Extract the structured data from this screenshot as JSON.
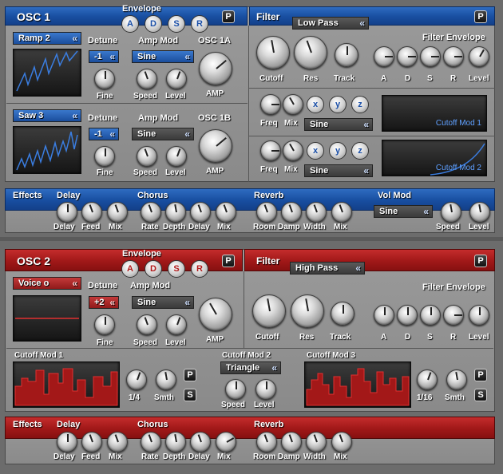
{
  "colors": {
    "blue": "#1a4fa8",
    "red": "#a31a1a",
    "panel": "#8f8f8f"
  },
  "osc_section": {
    "title": "OSC 1",
    "envelope_label": "Envelope",
    "env_buttons": [
      "A",
      "D",
      "S",
      "R"
    ],
    "p": "P",
    "filter_label": "Filter",
    "filter_type": "Low Pass",
    "filter_env_label": "Filter Envelope",
    "filter_knobs": [
      "Cutoff",
      "Res",
      "Track"
    ],
    "filter_env_knobs": [
      "A",
      "D",
      "S",
      "R",
      "Level"
    ],
    "osc_a": {
      "wave": "Ramp 2",
      "detune_label": "Detune",
      "detune": "-1",
      "ampmod_label": "Amp Mod",
      "ampmod": "Sine",
      "osc_label": "OSC 1A",
      "fine": "Fine",
      "speed": "Speed",
      "level": "Level",
      "amp": "AMP"
    },
    "osc_b": {
      "wave": "Saw 3",
      "detune_label": "Detune",
      "detune": "-1",
      "ampmod_label": "Amp Mod",
      "ampmod": "Sine",
      "osc_label": "OSC 1B",
      "fine": "Fine",
      "speed": "Speed",
      "level": "Level",
      "amp": "AMP"
    },
    "mod1": {
      "freq": "Freq",
      "mix": "Mix",
      "xyz": [
        "x",
        "y",
        "z"
      ],
      "shape": "Sine",
      "screen_label": "Cutoff Mod 1"
    },
    "mod2": {
      "freq": "Freq",
      "mix": "Mix",
      "xyz": [
        "x",
        "y",
        "z"
      ],
      "shape": "Sine",
      "screen_label": "Cutoff Mod 2"
    }
  },
  "effects1": {
    "effects": "Effects",
    "delay": "Delay",
    "chorus": "Chorus",
    "reverb": "Reverb",
    "volmod": "Vol Mod",
    "volmod_shape": "Sine",
    "knobs": [
      "Delay",
      "Feed",
      "Mix",
      "Rate",
      "Depth",
      "Delay",
      "Mix",
      "Room",
      "Damp",
      "Width",
      "Mix",
      "Speed",
      "Level"
    ]
  },
  "osc2": {
    "title": "OSC 2",
    "envelope_label": "Envelope",
    "env_buttons": [
      "A",
      "D",
      "S",
      "R"
    ],
    "p": "P",
    "filter_label": "Filter",
    "filter_type": "High Pass",
    "filter_env_label": "Filter Envelope",
    "wave": "Voice o",
    "detune_label": "Detune",
    "detune": "+2",
    "ampmod_label": "Amp Mod",
    "ampmod": "Sine",
    "fine": "Fine",
    "speed": "Speed",
    "level": "Level",
    "amp": "AMP",
    "filter_knobs": [
      "Cutoff",
      "Res",
      "Track"
    ],
    "filter_env_knobs": [
      "A",
      "D",
      "S",
      "R",
      "Level"
    ],
    "cm1": {
      "label": "Cutoff Mod 1",
      "rate": "1/4",
      "smth": "Smth",
      "p": "P",
      "s": "S"
    },
    "cm2": {
      "label": "Cutoff Mod 2",
      "shape": "Triangle",
      "speed": "Speed",
      "level": "Level"
    },
    "cm3": {
      "label": "Cutoff Mod 3",
      "rate": "1/16",
      "smth": "Smth",
      "p": "P",
      "s": "S"
    }
  },
  "effects2": {
    "effects": "Effects",
    "delay": "Delay",
    "chorus": "Chorus",
    "reverb": "Reverb",
    "knobs": [
      "Delay",
      "Feed",
      "Mix",
      "Rate",
      "Depth",
      "Delay",
      "Mix",
      "Room",
      "Damp",
      "Width",
      "Mix"
    ]
  }
}
